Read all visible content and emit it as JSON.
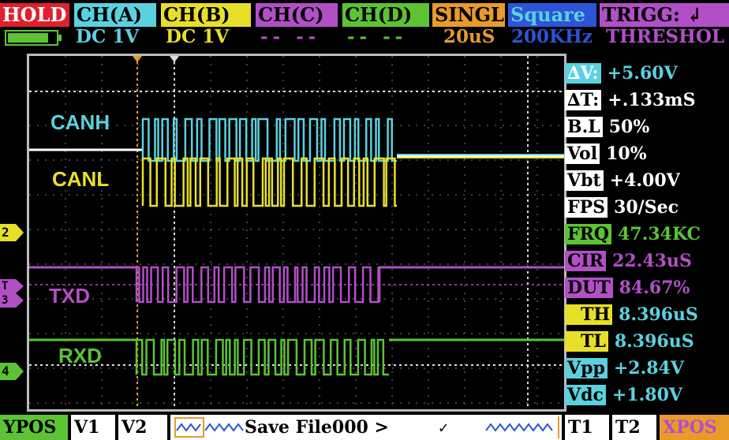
{
  "top_bar": {
    "hold": "HOLD",
    "ch_a": "CH(A)",
    "ch_b": "CH(B)",
    "ch_c": "CH(C)",
    "ch_d": "CH(D)",
    "mode": "SINGL",
    "wave": "Square",
    "trigger": "TRIGG: ↲"
  },
  "sub_bar": {
    "ch_a": "DC  1V",
    "ch_b": "DC  1V",
    "ch_c": "-- --",
    "ch_d": "-- --",
    "timebase": "20uS",
    "frequency": "200KHz",
    "threshold": "THRESHOL"
  },
  "battery": {
    "level": 0.8
  },
  "channel_labels": {
    "canh": "CANH",
    "canl": "CANL",
    "txd": "TXD",
    "rxd": "RXD"
  },
  "markers": {
    "m2": "2",
    "mt": "T",
    "m3": "3",
    "m4": "4"
  },
  "measurements": [
    {
      "key": "∆V:",
      "value": "+5.60V"
    },
    {
      "key": "∆T:",
      "value": "+.133mS"
    },
    {
      "key": "B.L",
      "value": "50%"
    },
    {
      "key": "Vol",
      "value": "10%"
    },
    {
      "key": "Vbt",
      "value": "+4.00V"
    },
    {
      "key": "FPS",
      "value": "30/Sec"
    },
    {
      "key": "FRQ",
      "value": "47.34KC"
    },
    {
      "key": "CIR",
      "value": "22.43uS"
    },
    {
      "key": "DUT",
      "value": "84.67%"
    },
    {
      "key": "TH",
      "value": "8.396uS"
    },
    {
      "key": "TL",
      "value": "8.396uS"
    },
    {
      "key": "Vpp",
      "value": "+2.84V"
    },
    {
      "key": "Vdc",
      "value": "+1.80V"
    }
  ],
  "bottom_bar": {
    "ypos": "YPOS",
    "v1": "V1",
    "v2": "V2",
    "file": "Save File000 >",
    "check": "✓",
    "t1": "T1",
    "t2": "T2",
    "xpos": "XPOS"
  },
  "colors": {
    "ch_a": "#5bd1e0",
    "ch_b": "#e8e028",
    "ch_c": "#b24fc7",
    "ch_d": "#5cc434",
    "hold": "#e0202f",
    "singl": "#e89b2a",
    "square": "#2d54d6",
    "trigger": "#b24fc7"
  }
}
